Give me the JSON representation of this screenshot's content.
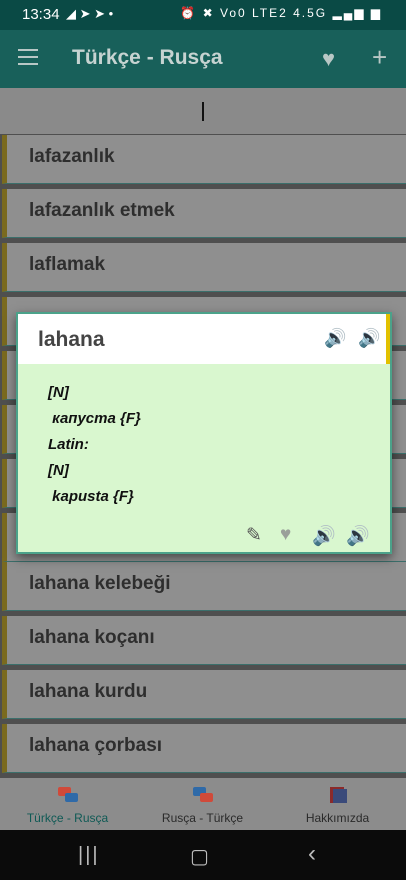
{
  "status": {
    "time": "13:34",
    "left_icons": "◢ ➤ ➤ •",
    "right_icons": "⏰ ✖ Vo0 LTE2 4.5G ▂▄▆ ▆"
  },
  "appbar": {
    "title": "Türkçe - Rusça",
    "menu_icon": "menu-icon",
    "favorite_icon": "heart-icon",
    "add_icon": "plus-icon"
  },
  "search": {
    "value": ""
  },
  "list": {
    "items": [
      "lafazanlık",
      "lafazanlık etmek",
      "laflamak",
      "",
      "",
      "",
      "",
      "",
      "lahana kelebeği",
      "lahana koçanı",
      "lahana kurdu",
      "lahana çorbası"
    ]
  },
  "dialog": {
    "title": "lahana",
    "lines": [
      "[N]",
      " капуста {F}",
      "Latin:",
      "[N]",
      " kapusta {F}"
    ],
    "actions": [
      "edit-icon",
      "favorite-icon",
      "speaker-red-icon",
      "speaker-green-icon"
    ]
  },
  "bottom_nav": {
    "items": [
      {
        "label": "Türkçe - Rusça",
        "active": true
      },
      {
        "label": "Rusça - Türkçe",
        "active": false
      },
      {
        "label": "Hakkımızda",
        "active": false
      }
    ]
  },
  "colors": {
    "appbar": "#18605a",
    "dialog_body": "#d9f7cf",
    "accent_yellow": "#e2c100",
    "speaker_red": "#c23b14",
    "speaker_green": "#1e9a2a"
  }
}
